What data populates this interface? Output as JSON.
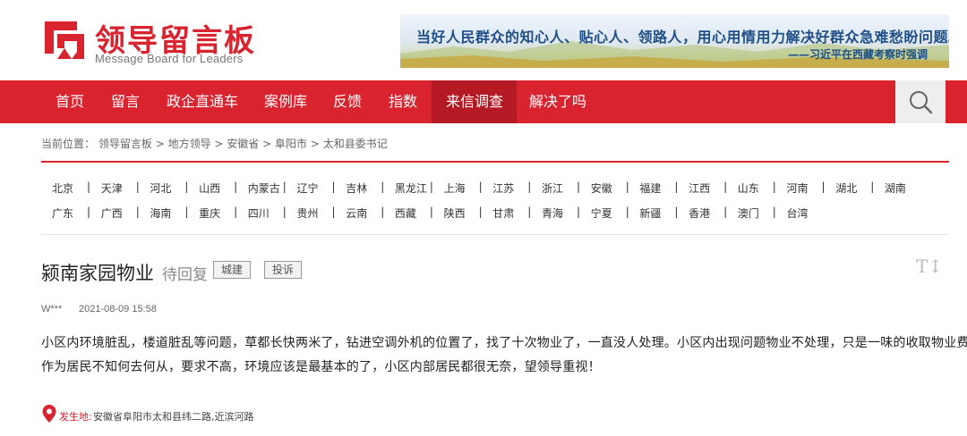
{
  "header": {
    "logo_title": "领导留言板",
    "logo_subtitle": "Message Board for Leaders",
    "banner_text": "当好人民群众的知心人、贴心人、领路人，用心用情用力解决好群众急难愁盼问题。",
    "banner_quote": "——习近平在西藏考察时强调"
  },
  "nav": {
    "items": [
      "首页",
      "留言",
      "政企直通车",
      "案例库",
      "反馈",
      "指数",
      "来信调查",
      "解决了吗"
    ],
    "active": "来信调查",
    "search_icon": "search-icon"
  },
  "breadcrumb": {
    "prefix": "当前位置：",
    "items": [
      "领导留言板",
      "地方领导",
      "安徽省",
      "阜阳市",
      "太和县委书记"
    ],
    "separator": ">"
  },
  "provinces": {
    "row1": [
      "北京",
      "天津",
      "河北",
      "山西",
      "内蒙古",
      "辽宁",
      "吉林",
      "黑龙江",
      "上海",
      "江苏",
      "浙江",
      "安徽",
      "福建",
      "江西",
      "山东",
      "河南",
      "湖北",
      "湖南"
    ],
    "row2": [
      "广东",
      "广西",
      "海南",
      "重庆",
      "四川",
      "贵州",
      "云南",
      "西藏",
      "陕西",
      "甘肃",
      "青海",
      "宁夏",
      "新疆",
      "香港",
      "澳门",
      "台湾"
    ],
    "separator": "|"
  },
  "message": {
    "title": "颍南家园物业",
    "status": "待回复",
    "tags": [
      "城建",
      "投诉"
    ],
    "font_toggle": "T↕",
    "author": "W***",
    "date": "2021-08-09 15:58",
    "body_lines": [
      "小区内环境脏乱，楼道脏乱等问题，草都长快两米了，钻进空调外机的位置了，找了十次物业了，一直没人处理。小区内出现问题物业不处理，只是一味的收取物业费用。",
      "作为居民不知何去何从，要求不高，环境应该是最基本的了，小区内部居民都很无奈，望领导重视！"
    ],
    "location_label": "发生地:",
    "location": "安徽省阜阳市太和县纬二路,近滨河路"
  },
  "colors": {
    "brand": "#d9232f",
    "nav_active": "#b51a24",
    "banner_text": "#1f4f86"
  }
}
